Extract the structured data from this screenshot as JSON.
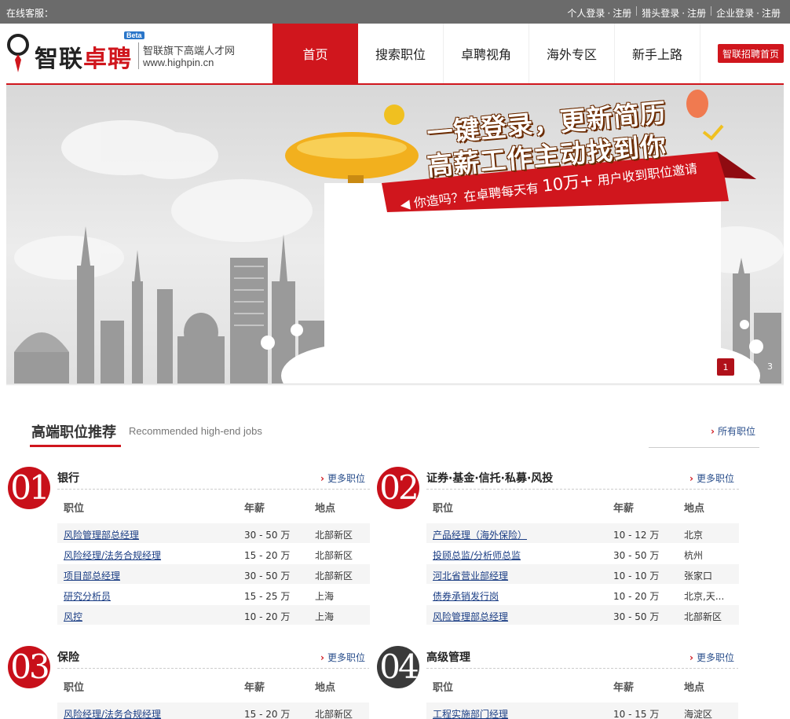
{
  "topbar": {
    "service_label": "在线客服：",
    "personal_login": "个人登录",
    "personal_register": "注册",
    "headhunter_login": "猎头登录",
    "headhunter_register": "注册",
    "company_login": "企业登录",
    "company_register": "注册"
  },
  "header": {
    "logo_part1": "智联",
    "logo_part2": "卓聘",
    "beta": "Beta",
    "tagline": "智联旗下高端人才网",
    "domain": "www.highpin.cn",
    "nav": [
      "首页",
      "搜索职位",
      "卓聘视角",
      "海外专区",
      "新手上路"
    ],
    "active_nav": 0,
    "zhaopin_button": "智联招聘首页"
  },
  "banner": {
    "headline1": "一键登录，更新简历",
    "headline2": "高薪工作主动找到你",
    "ribbon_text_prefix": "你造吗？在卓聘每天有 ",
    "ribbon_number": "10万+",
    "ribbon_text_suffix": " 用户收到职位邀请",
    "current_slide": "1",
    "last_slide": "3"
  },
  "section": {
    "title": "高端职位推荐",
    "subtitle": "Recommended high-end jobs",
    "all_jobs": "所有职位"
  },
  "columns": {
    "position": "职位",
    "salary": "年薪",
    "location": "地点"
  },
  "more_label": "更多职位",
  "categories": [
    {
      "num": "01",
      "name": "银行",
      "jobs": [
        {
          "title": "风险管理部总经理",
          "salary": "30 - 50 万",
          "location": "北部新区"
        },
        {
          "title": "风险经理/法务合规经理",
          "salary": "15 - 20 万",
          "location": "北部新区"
        },
        {
          "title": "项目部总经理",
          "salary": "30 - 50 万",
          "location": "北部新区"
        },
        {
          "title": "研究分析员",
          "salary": "15 - 25 万",
          "location": "上海"
        },
        {
          "title": "风控",
          "salary": "10 - 20 万",
          "location": "上海"
        }
      ]
    },
    {
      "num": "02",
      "name": "证券·基金·信托·私募·风投",
      "jobs": [
        {
          "title": "产品经理（海外保险）",
          "salary": "10 - 12 万",
          "location": "北京"
        },
        {
          "title": "投顾总监/分析师总监",
          "salary": "30 - 50 万",
          "location": "杭州"
        },
        {
          "title": "河北省营业部经理",
          "salary": "10 - 10 万",
          "location": "张家口"
        },
        {
          "title": "债券承销发行岗",
          "salary": "10 - 20 万",
          "location": "北京,天..."
        },
        {
          "title": "风险管理部总经理",
          "salary": "30 - 50 万",
          "location": "北部新区"
        }
      ]
    },
    {
      "num": "03",
      "name": "保险",
      "jobs": [
        {
          "title": "风险经理/法务合规经理",
          "salary": "15 - 20 万",
          "location": "北部新区"
        }
      ]
    },
    {
      "num": "04",
      "name": "高级管理",
      "jobs": [
        {
          "title": "工程实施部门经理",
          "salary": "10 - 15 万",
          "location": "海淀区"
        }
      ]
    }
  ]
}
